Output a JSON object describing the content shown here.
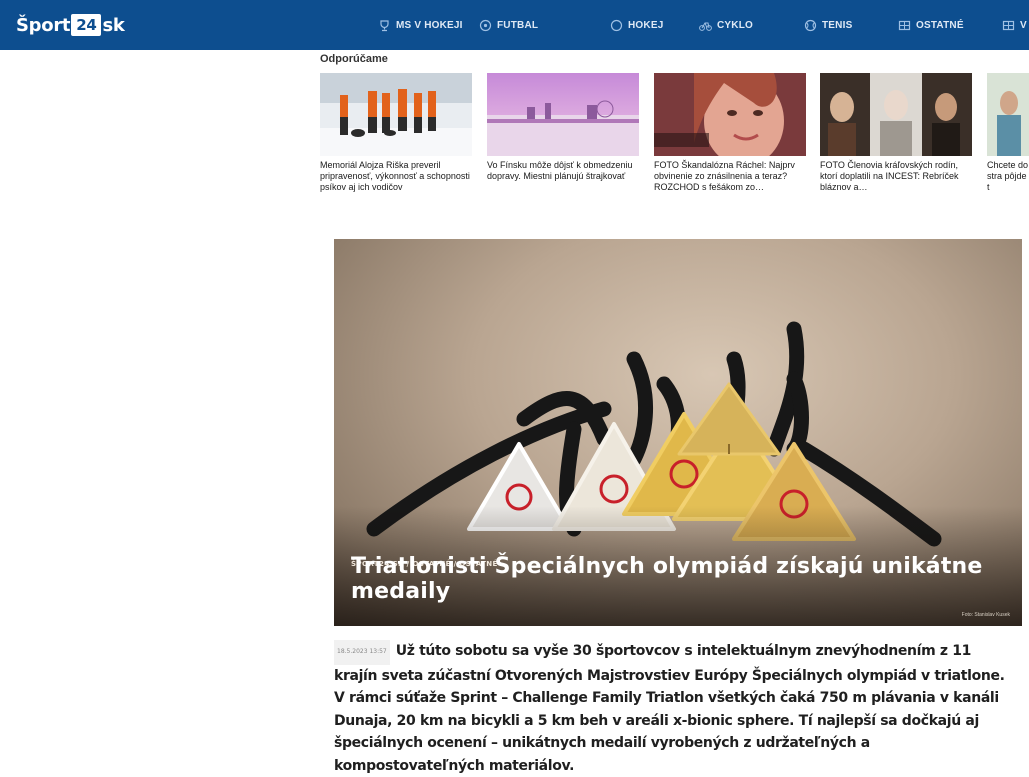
{
  "site": {
    "logo_part1": "Šport",
    "logo_box": "24",
    "logo_part2": "sk"
  },
  "nav": [
    {
      "label": "MS V HOKEJI",
      "icon": "hockey-trophy-icon"
    },
    {
      "label": "FUTBAL",
      "icon": "football-icon"
    },
    {
      "label": "HOKEJ",
      "icon": "hockey-puck-icon"
    },
    {
      "label": "CYKLO",
      "icon": "bicycle-icon"
    },
    {
      "label": "TENIS",
      "icon": "tennis-ball-icon"
    },
    {
      "label": "OSTATNÉ",
      "icon": "grid-icon"
    },
    {
      "label": "V",
      "icon": "grid-icon"
    }
  ],
  "recommended": {
    "heading": "Odporúčame",
    "items": [
      {
        "title": "Memoriál Alojza Riška preveril pripravenosť, výkonnosť a schopnosti psíkov aj ich vodičov"
      },
      {
        "title": "Vo Fínsku môže dôjsť k obmedzeniu dopravy. Miestni plánujú štrajkovať"
      },
      {
        "title": "FOTO Škandalózna Ráchel: Najprv obvinenie zo znásilnenia a teraz? ROZCHOD s fešákom zo…"
      },
      {
        "title": "FOTO Členovia kráľovských rodín, ktorí doplatili na INCEST: Rebríček bláznov a…"
      },
      {
        "title": "Chcete do stra pôjde t"
      }
    ]
  },
  "hero": {
    "breadcrumb": "ŠPORT24.SK / OSTATNÉ / OSTATNÉ",
    "title": "Triatlonisti Špeciálnych olympiád získajú unikátne medaily",
    "photo_credit": "Foto: Stanislav Kusek"
  },
  "article": {
    "date": "18.5.2023 13:57",
    "lead": "Už túto sobotu sa vyše 30 športovcov s intelektuálnym znevýhodnením z 11 krajín sveta zúčastní Otvorených Majstrovstiev Európy Špeciálnych olympiád v triatlone. V rámci súťaže Sprint – Challenge Family Triatlon všetkých čaká 750 m plávania v kanáli Dunaja, 20 km na bicykli a 5 km beh v areáli x-bionic sphere. Tí najlepší sa dočkajú aj špeciálnych ocenení – unikátnych medailí vyrobených z udržateľných a kompostovateľných materiálov."
  }
}
